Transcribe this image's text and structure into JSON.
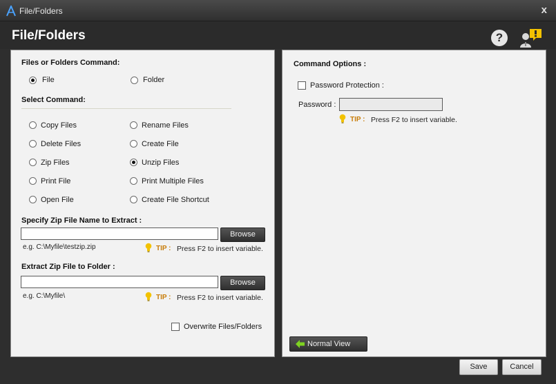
{
  "window": {
    "title": "File/Folders",
    "close_glyph": "x"
  },
  "header": {
    "title": "File/Folders",
    "help_glyph": "?",
    "icons": [
      "help-icon",
      "user-alert-icon"
    ]
  },
  "left": {
    "command_type_label": "Files or Folders Command:",
    "command_types": [
      {
        "label": "File",
        "checked": true
      },
      {
        "label": "Folder",
        "checked": false
      }
    ],
    "select_command_label": "Select Command:",
    "commands": [
      {
        "label": "Copy Files",
        "checked": false
      },
      {
        "label": "Rename Files",
        "checked": false
      },
      {
        "label": "Delete Files",
        "checked": false
      },
      {
        "label": "Create File",
        "checked": false
      },
      {
        "label": "Zip Files",
        "checked": false
      },
      {
        "label": "Unzip Files",
        "checked": true
      },
      {
        "label": "Print File",
        "checked": false
      },
      {
        "label": "Print Multiple Files",
        "checked": false
      },
      {
        "label": "Open File",
        "checked": false
      },
      {
        "label": "Create File Shortcut",
        "checked": false
      }
    ],
    "zip_name": {
      "label": "Specify Zip File Name to Extract :",
      "value": "",
      "browse": "Browse",
      "example": "e.g. C:\\Myfile\\testzip.zip",
      "tip_label": "TIP :",
      "tip_text": "Press F2 to insert variable."
    },
    "extract_folder": {
      "label": "Extract Zip File to Folder :",
      "value": "",
      "browse": "Browse",
      "example": "e.g. C:\\Myfile\\",
      "tip_label": "TIP :",
      "tip_text": "Press F2 to insert variable."
    },
    "overwrite": {
      "label": "Overwrite Files/Folders",
      "checked": false
    }
  },
  "right": {
    "options_label": "Command Options :",
    "password_protection": {
      "label": "Password Protection :",
      "checked": false
    },
    "password": {
      "label": "Password :",
      "value": ""
    },
    "tip_label": "TIP :",
    "tip_text": "Press F2 to insert variable.",
    "normal_view": "Normal View"
  },
  "footer": {
    "save": "Save",
    "cancel": "Cancel"
  },
  "colors": {
    "accent_tip": "#c87d0a",
    "bulb": "#f2c200",
    "alert": "#f2c200",
    "arrow": "#7ed321"
  }
}
